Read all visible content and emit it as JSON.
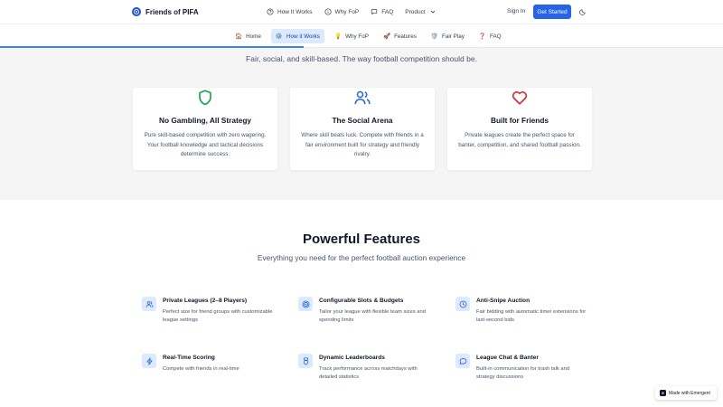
{
  "brand": {
    "name": "Friends of PIFA",
    "logo_icon": "soccer-ball-icon",
    "logo_color": "#1d4ed8"
  },
  "topnav": {
    "items": [
      {
        "label": "How It Works",
        "icon": "question-circle-icon"
      },
      {
        "label": "Why FoP",
        "icon": "info-circle-icon"
      },
      {
        "label": "FAQ",
        "icon": "chat-bubble-icon"
      },
      {
        "label": "Product",
        "icon": "chevron-down-icon"
      }
    ],
    "signin_label": "Sign In",
    "cta_label": "Get Started",
    "theme_icon": "moon-icon",
    "accent": "#2563eb"
  },
  "subnav": {
    "progress_percent": 42,
    "tabs": [
      {
        "emoji": "🏠",
        "label": "Home",
        "active": false
      },
      {
        "emoji": "⚙️",
        "label": "How it Works",
        "active": true
      },
      {
        "emoji": "💡",
        "label": "Why FoP",
        "active": false
      },
      {
        "emoji": "🚀",
        "label": "Features",
        "active": false
      },
      {
        "emoji": "🛡️",
        "label": "Fair Play",
        "active": false
      },
      {
        "emoji": "❓",
        "label": "FAQ",
        "active": false
      }
    ]
  },
  "hero": {
    "tagline": "Fair, social, and skill-based. The way football competition should be.",
    "cards": [
      {
        "icon": "shield-icon",
        "color": "#16a34a",
        "title": "No Gambling, All Strategy",
        "desc": "Pure skill-based competition with zero wagering. Your football knowledge and tactical decisions determine success."
      },
      {
        "icon": "users-icon",
        "color": "#2563eb",
        "title": "The Social Arena",
        "desc": "Where skill beats luck. Compete with friends in a fair environment built for strategy and friendly rivalry."
      },
      {
        "icon": "heart-icon",
        "color": "#dc2626",
        "title": "Built for Friends",
        "desc": "Private leagues create the perfect space for banter, competition, and shared football passion."
      }
    ]
  },
  "features": {
    "title": "Powerful Features",
    "subtitle": "Everything you need for the perfect football auction experience",
    "items": [
      {
        "icon": "users-icon",
        "title": "Private Leagues (2–8 Players)",
        "desc": "Perfect size for friend groups with customizable league settings"
      },
      {
        "icon": "target-icon",
        "title": "Configurable Slots & Budgets",
        "desc": "Tailor your league with flexible team sizes and spending limits"
      },
      {
        "icon": "clock-icon",
        "title": "Anti-Snipe Auction",
        "desc": "Fair bidding with automatic timer extensions for last-second bids"
      },
      {
        "icon": "lightning-icon",
        "title": "Real-Time Scoring",
        "desc": "Compete with friends in real-time"
      },
      {
        "icon": "medal-icon",
        "title": "Dynamic Leaderboards",
        "desc": "Track performance across matchdays with detailed statistics"
      },
      {
        "icon": "chat-bubble-icon",
        "title": "League Chat & Banter",
        "desc": "Built-in communication for trash talk and strategy discussions"
      }
    ]
  },
  "badge": {
    "label": "Made with Emergent",
    "logo_letter": "e"
  }
}
